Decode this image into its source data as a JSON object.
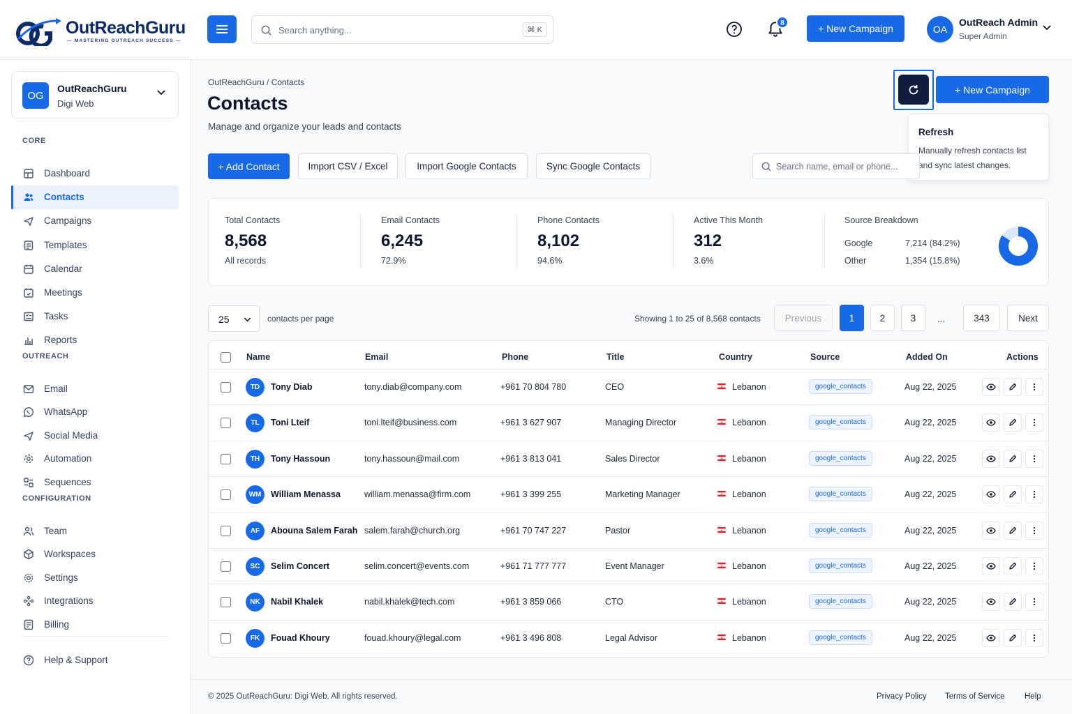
{
  "brand": {
    "name": "OutReachGuru",
    "tagline": "MASTERING OUTREACH SUCCESS"
  },
  "header": {
    "search_placeholder": "Search anything...",
    "search_shortcut": "⌘ K",
    "notification_count": "8",
    "new_campaign": "+ New Campaign",
    "user": {
      "initials": "OA",
      "name": "OutReach Admin",
      "role": "Super Admin"
    }
  },
  "workspace": {
    "initials": "OG",
    "name": "OutReachGuru",
    "sub": "Digi Web"
  },
  "sidebar": {
    "sections": [
      {
        "title": "CORE",
        "items": [
          {
            "label": "Dashboard",
            "icon": "dashboard-icon"
          },
          {
            "label": "Contacts",
            "icon": "contacts-icon",
            "active": true
          },
          {
            "label": "Campaigns",
            "icon": "campaigns-icon"
          },
          {
            "label": "Templates",
            "icon": "templates-icon"
          },
          {
            "label": "Calendar",
            "icon": "calendar-icon"
          },
          {
            "label": "Meetings",
            "icon": "meetings-icon"
          },
          {
            "label": "Tasks",
            "icon": "tasks-icon"
          },
          {
            "label": "Reports",
            "icon": "reports-icon"
          }
        ]
      },
      {
        "title": "OUTREACH",
        "items": [
          {
            "label": "Email",
            "icon": "email-icon"
          },
          {
            "label": "WhatsApp",
            "icon": "whatsapp-icon"
          },
          {
            "label": "Social Media",
            "icon": "social-media-icon"
          },
          {
            "label": "Automation",
            "icon": "automation-icon"
          },
          {
            "label": "Sequences",
            "icon": "sequences-icon"
          }
        ]
      },
      {
        "title": "CONFIGURATION",
        "items": [
          {
            "label": "Team",
            "icon": "team-icon"
          },
          {
            "label": "Workspaces",
            "icon": "workspaces-icon"
          },
          {
            "label": "Settings",
            "icon": "settings-icon"
          },
          {
            "label": "Integrations",
            "icon": "integrations-icon"
          },
          {
            "label": "Billing",
            "icon": "billing-icon"
          }
        ]
      }
    ],
    "help": "Help & Support"
  },
  "page": {
    "breadcrumb": "OutReachGuru / Contacts",
    "title": "Contacts",
    "subtitle": "Manage and organize your leads and contacts",
    "new_campaign": "+ New Campaign",
    "tooltip": {
      "title": "Refresh",
      "body": "Manually refresh contacts list and sync latest changes."
    },
    "actions": {
      "add_contact": "+ Add Contact",
      "import_csv": "Import CSV / Excel",
      "import_google": "Import Google Contacts",
      "sync_google": "Sync Google Contacts",
      "search_placeholder": "Search name, email or phone..."
    }
  },
  "stats": [
    {
      "label": "Total Contacts",
      "value": "8,568",
      "sub": "All records"
    },
    {
      "label": "Email Contacts",
      "value": "6,245",
      "sub": "72.9%"
    },
    {
      "label": "Phone Contacts",
      "value": "8,102",
      "sub": "94.6%"
    },
    {
      "label": "Active This Month",
      "value": "312",
      "sub": "3.6%"
    }
  ],
  "source_breakdown": {
    "label": "Source Breakdown",
    "rows": [
      {
        "name": "Google",
        "value": "7,214 (84.2%)",
        "fraction": 0.842
      },
      {
        "name": "Other",
        "value": "1,354 (15.8%)",
        "fraction": 0.158
      }
    ]
  },
  "pagination": {
    "per_page": "25",
    "per_page_label": "contacts per page",
    "showing": "Showing 1 to 25 of 8,568 contacts",
    "previous": "Previous",
    "pages": [
      "1",
      "2",
      "3",
      "...",
      "343"
    ],
    "next": "Next"
  },
  "table": {
    "columns": [
      "Name",
      "Email",
      "Phone",
      "Title",
      "Country",
      "Source",
      "Added On",
      "Actions"
    ],
    "rows": [
      {
        "initials": "TD",
        "name": "Tony Diab",
        "email": "tony.diab@company.com",
        "phone": "+961 70 804 780",
        "title": "CEO",
        "country": "Lebanon",
        "source": "google_contacts",
        "added": "Aug 22, 2025"
      },
      {
        "initials": "TL",
        "name": "Toni Lteif",
        "email": "toni.lteif@business.com",
        "phone": "+961 3 627 907",
        "title": "Managing Director",
        "country": "Lebanon",
        "source": "google_contacts",
        "added": "Aug 22, 2025"
      },
      {
        "initials": "TH",
        "name": "Tony Hassoun",
        "email": "tony.hassoun@mail.com",
        "phone": "+961 3 813 041",
        "title": "Sales Director",
        "country": "Lebanon",
        "source": "google_contacts",
        "added": "Aug 22, 2025"
      },
      {
        "initials": "WM",
        "name": "William Menassa",
        "email": "william.menassa@firm.com",
        "phone": "+961 3 399 255",
        "title": "Marketing Manager",
        "country": "Lebanon",
        "source": "google_contacts",
        "added": "Aug 22, 2025"
      },
      {
        "initials": "AF",
        "name": "Abouna Salem Farah",
        "email": "salem.farah@church.org",
        "phone": "+961 70 747 227",
        "title": "Pastor",
        "country": "Lebanon",
        "source": "google_contacts",
        "added": "Aug 22, 2025"
      },
      {
        "initials": "SC",
        "name": "Selim Concert",
        "email": "selim.concert@events.com",
        "phone": "+961 71 777 777",
        "title": "Event Manager",
        "country": "Lebanon",
        "source": "google_contacts",
        "added": "Aug 22, 2025"
      },
      {
        "initials": "NK",
        "name": "Nabil Khalek",
        "email": "nabil.khalek@tech.com",
        "phone": "+961 3 859 066",
        "title": "CTO",
        "country": "Lebanon",
        "source": "google_contacts",
        "added": "Aug 22, 2025"
      },
      {
        "initials": "FK",
        "name": "Fouad Khoury",
        "email": "fouad.khoury@legal.com",
        "phone": "+961 3 496 808",
        "title": "Legal Advisor",
        "country": "Lebanon",
        "source": "google_contacts",
        "added": "Aug 22, 2025"
      }
    ]
  },
  "footer": {
    "copyright": "© 2025 OutReachGuru: Digi Web. All rights reserved.",
    "links": [
      "Privacy Policy",
      "Terms of Service",
      "Help"
    ]
  },
  "colors": {
    "accent": "#1769e6",
    "dark": "#0f1f3d",
    "border": "#e5e7eb"
  }
}
